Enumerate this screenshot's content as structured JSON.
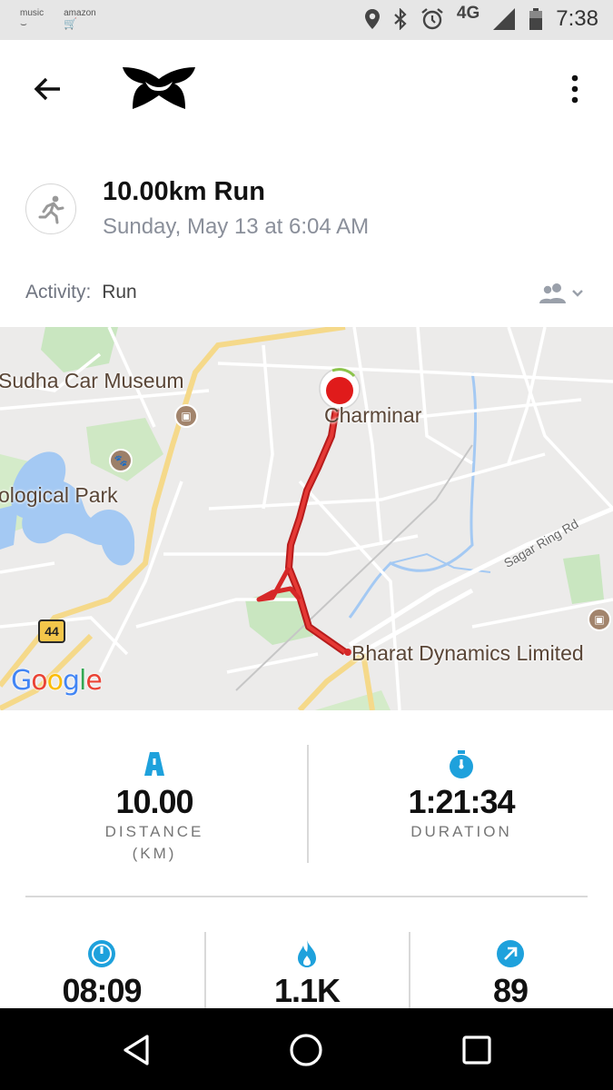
{
  "status_bar": {
    "apps": [
      "music",
      "amazon"
    ],
    "network": "4G",
    "time": "7:38",
    "icons": [
      "location-icon",
      "bluetooth-icon",
      "alarm-icon",
      "signal-icon",
      "battery-icon"
    ]
  },
  "app_bar": {
    "back_icon": "arrow-left-icon",
    "logo": "under-armour-logo",
    "menu_icon": "more-vert-icon"
  },
  "workout": {
    "title": "10.00km Run",
    "date": "Sunday, May 13 at 6:04 AM",
    "activity_label": "Activity:",
    "activity_value": "Run",
    "privacy_icon": "friends-icon"
  },
  "map": {
    "labels": {
      "museum": "Sudha Car Museum",
      "park": "ological Park",
      "charminar": "Charminar",
      "bharat": "Bharat Dynamics Limited",
      "ring_road": "Sagar Ring Rd",
      "highway": "44"
    },
    "attribution": "Google",
    "route_color": "#d62828"
  },
  "stats": {
    "distance": {
      "value": "10.00",
      "label": "DISTANCE",
      "unit": "(KM)",
      "icon": "road-icon"
    },
    "duration": {
      "value": "1:21:34",
      "label": "DURATION",
      "icon": "stopwatch-icon"
    },
    "pace": {
      "value": "08:09",
      "icon": "speedometer-icon"
    },
    "calories": {
      "value": "1.1K",
      "icon": "flame-icon"
    },
    "elevation": {
      "value": "89",
      "icon": "arrow-up-right-icon"
    }
  },
  "colors": {
    "accent": "#1ea1dc",
    "route": "#d62828",
    "muted_text": "#8a8f9a"
  },
  "nav_bar": {
    "back": "nav-back-icon",
    "home": "nav-home-icon",
    "recents": "nav-recents-icon"
  }
}
